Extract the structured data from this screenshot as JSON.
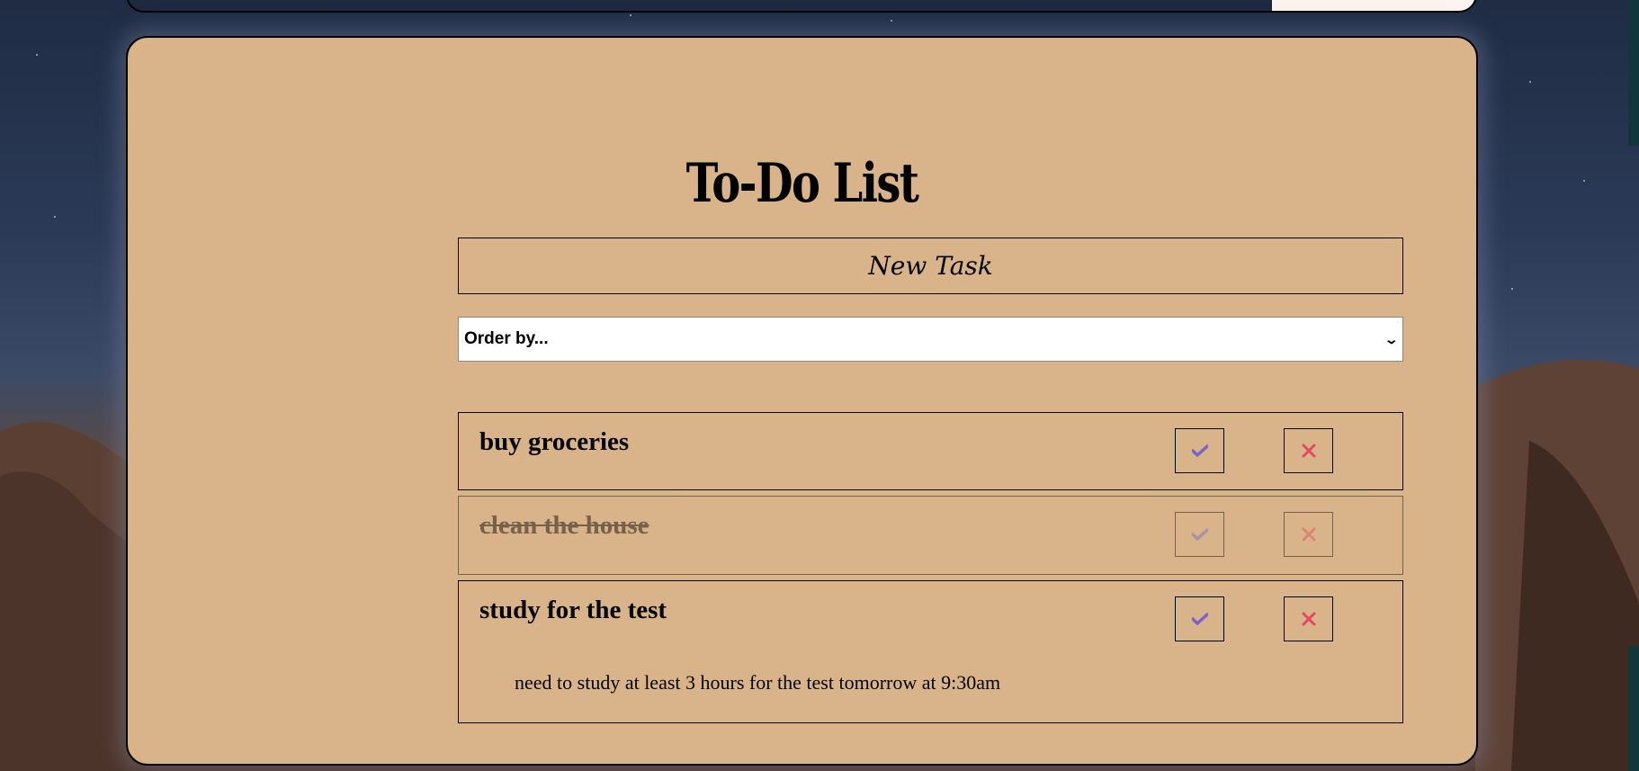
{
  "app": {
    "title": "To-Do List"
  },
  "new_task_button": {
    "label": "New Task"
  },
  "order_select": {
    "selected": "Order by..."
  },
  "tasks": [
    {
      "title": "buy groceries",
      "completed": false,
      "description": ""
    },
    {
      "title": "clean the house",
      "completed": true,
      "description": ""
    },
    {
      "title": "study for the test",
      "completed": false,
      "description": "need to study at least 3 hours for the test tomorrow at 9:30am"
    }
  ],
  "icons": {
    "complete": "check-icon",
    "delete": "close-icon"
  },
  "colors": {
    "card": "#d9b48a",
    "check": "#7b63c8",
    "delete": "#e04a62"
  }
}
